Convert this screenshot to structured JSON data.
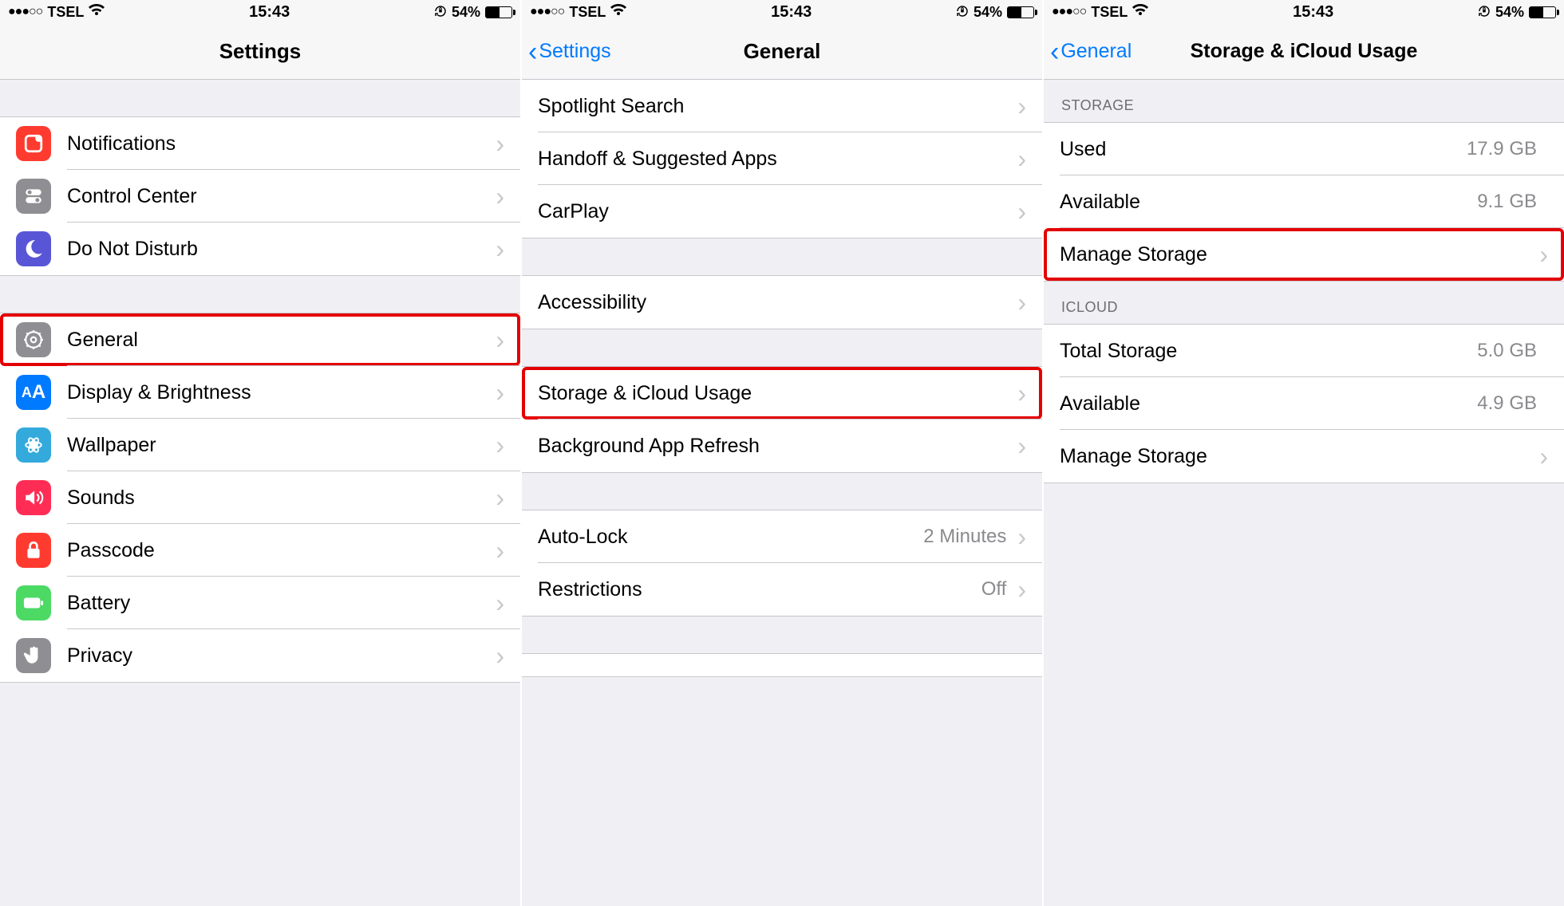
{
  "status": {
    "carrier": "TSEL",
    "signal_dots": "●●●○○",
    "time": "15:43",
    "battery_pct": "54%",
    "battery_fill": 54
  },
  "screen1": {
    "title": "Settings",
    "group1": [
      {
        "id": "notifications",
        "label": "Notifications",
        "icon": "notifications-icon",
        "bg": "ic-red"
      },
      {
        "id": "control-center",
        "label": "Control Center",
        "icon": "control-center-icon",
        "bg": "ic-gray"
      },
      {
        "id": "dnd",
        "label": "Do Not Disturb",
        "icon": "moon-icon",
        "bg": "ic-indigo"
      }
    ],
    "group2": [
      {
        "id": "general",
        "label": "General",
        "icon": "gear-icon",
        "bg": "ic-darkgray",
        "highlight": true
      },
      {
        "id": "display",
        "label": "Display & Brightness",
        "icon": "aa-icon",
        "bg": "ic-blueAA"
      },
      {
        "id": "wallpaper",
        "label": "Wallpaper",
        "icon": "flower-icon",
        "bg": "ic-cyan"
      },
      {
        "id": "sounds",
        "label": "Sounds",
        "icon": "speaker-icon",
        "bg": "ic-pink"
      },
      {
        "id": "passcode",
        "label": "Passcode",
        "icon": "lock-icon",
        "bg": "ic-redlock"
      },
      {
        "id": "battery",
        "label": "Battery",
        "icon": "battery-icon",
        "bg": "ic-green"
      },
      {
        "id": "privacy",
        "label": "Privacy",
        "icon": "hand-icon",
        "bg": "ic-gray2"
      }
    ]
  },
  "screen2": {
    "back": "Settings",
    "title": "General",
    "group1": [
      {
        "id": "spotlight",
        "label": "Spotlight Search"
      },
      {
        "id": "handoff",
        "label": "Handoff & Suggested Apps"
      },
      {
        "id": "carplay",
        "label": "CarPlay"
      }
    ],
    "group2": [
      {
        "id": "accessibility",
        "label": "Accessibility"
      }
    ],
    "group3": [
      {
        "id": "storage",
        "label": "Storage & iCloud Usage",
        "highlight": true
      },
      {
        "id": "bgrefresh",
        "label": "Background App Refresh"
      }
    ],
    "group4": [
      {
        "id": "autolock",
        "label": "Auto-Lock",
        "value": "2 Minutes"
      },
      {
        "id": "restrictions",
        "label": "Restrictions",
        "value": "Off"
      }
    ]
  },
  "screen3": {
    "back": "General",
    "title": "Storage & iCloud Usage",
    "storage_header": "STORAGE",
    "storage_rows": [
      {
        "id": "used",
        "label": "Used",
        "value": "17.9 GB",
        "chevron": false
      },
      {
        "id": "available",
        "label": "Available",
        "value": "9.1 GB",
        "chevron": false
      },
      {
        "id": "manage1",
        "label": "Manage Storage",
        "chevron": true,
        "highlight": true
      }
    ],
    "icloud_header": "ICLOUD",
    "icloud_rows": [
      {
        "id": "total",
        "label": "Total Storage",
        "value": "5.0 GB",
        "chevron": false
      },
      {
        "id": "iavail",
        "label": "Available",
        "value": "4.9 GB",
        "chevron": false
      },
      {
        "id": "manage2",
        "label": "Manage Storage",
        "chevron": true
      }
    ]
  }
}
